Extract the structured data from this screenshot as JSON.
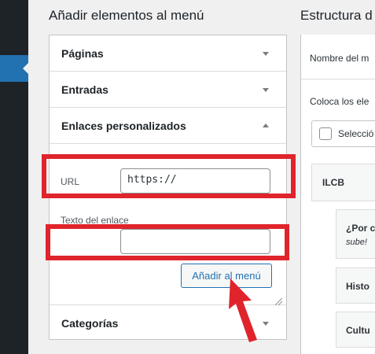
{
  "sidebar": {
    "active_icon": "menu-arrow-icon"
  },
  "add_items": {
    "title": "Añadir elementos al menú",
    "sections": [
      {
        "label": "Páginas",
        "state": "collapsed"
      },
      {
        "label": "Entradas",
        "state": "collapsed"
      },
      {
        "label": "Enlaces personalizados",
        "state": "expanded"
      },
      {
        "label": "Categorías",
        "state": "collapsed"
      }
    ],
    "custom_link": {
      "url_label": "URL",
      "url_value": "https://",
      "text_label": "Texto del enlace",
      "text_value": "",
      "button_label": "Añadir al menú"
    }
  },
  "structure": {
    "title": "Estructura d",
    "menu_name_label": "Nombre del m",
    "instructions": "Coloca los ele",
    "select_all_label": "Selecció",
    "items": [
      {
        "title": "ILCB"
      },
      {
        "title": "¿Por c",
        "subtitle": "sube!"
      },
      {
        "title": "Histo"
      },
      {
        "title": "Cultu"
      }
    ]
  },
  "annotations": {
    "highlight_color": "#e0242b",
    "arrow_color": "#e0242b"
  }
}
